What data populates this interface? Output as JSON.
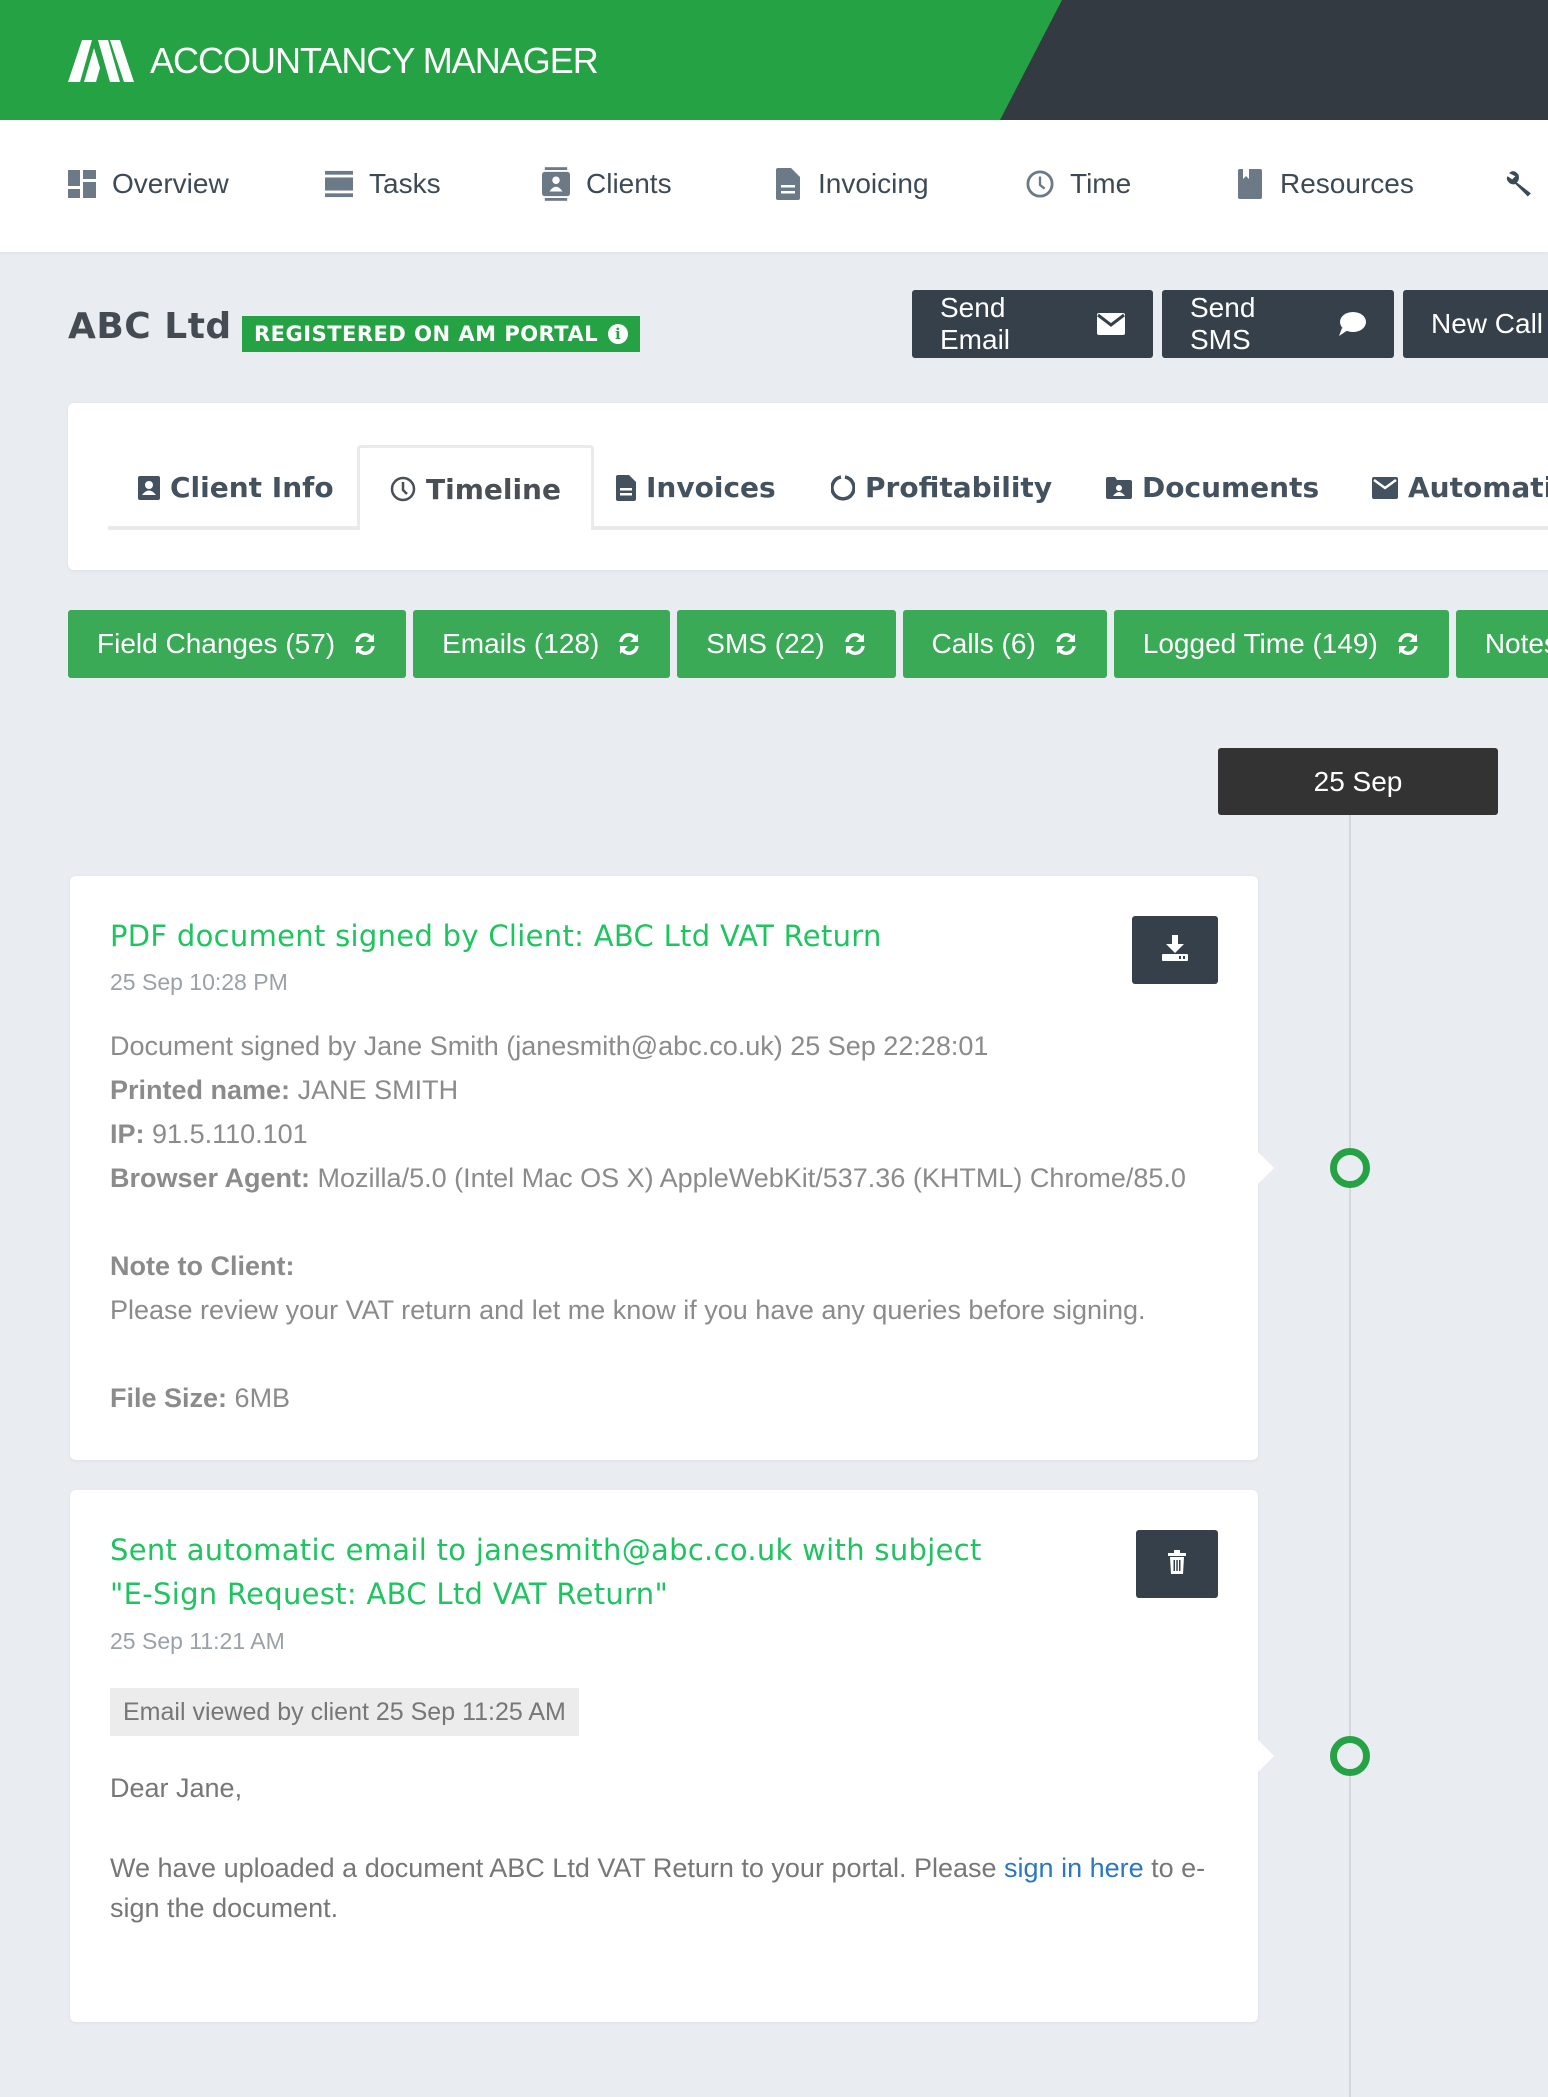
{
  "app": {
    "logo_text": "ACCOUNTANCY MANAGER",
    "brand_color": "#25a244",
    "dark_color": "#343a42"
  },
  "nav": {
    "items": [
      {
        "label": "Overview",
        "icon": "dashboard-icon"
      },
      {
        "label": "Tasks",
        "icon": "tasks-list-icon"
      },
      {
        "label": "Clients",
        "icon": "contact-card-icon"
      },
      {
        "label": "Invoicing",
        "icon": "document-icon"
      },
      {
        "label": "Time",
        "icon": "clock-icon"
      },
      {
        "label": "Resources",
        "icon": "book-icon"
      },
      {
        "label": "",
        "icon": "wrench-icon"
      }
    ]
  },
  "client": {
    "name": "ABC Ltd",
    "badge": "REGISTERED ON AM PORTAL"
  },
  "actions": {
    "send_email": "Send Email",
    "send_sms": "Send SMS",
    "new_call": "New Call"
  },
  "tabs": [
    {
      "label": "Client Info",
      "icon": "contact-card-icon",
      "active": false
    },
    {
      "label": "Timeline",
      "icon": "clock-icon",
      "active": true
    },
    {
      "label": "Invoices",
      "icon": "document-icon",
      "active": false
    },
    {
      "label": "Profitability",
      "icon": "spinner-icon",
      "active": false
    },
    {
      "label": "Documents",
      "icon": "folder-user-icon",
      "active": false
    },
    {
      "label": "Automatic",
      "icon": "envelope-icon",
      "active": false
    }
  ],
  "filters": [
    {
      "label": "Field Changes (57)"
    },
    {
      "label": "Emails (128)"
    },
    {
      "label": "SMS (22)"
    },
    {
      "label": "Calls (6)"
    },
    {
      "label": "Logged Time (149)"
    },
    {
      "label": "Notes"
    }
  ],
  "timeline": {
    "date_label": "25 Sep",
    "events": [
      {
        "title": "PDF document signed by Client: ABC Ltd VAT Return",
        "date": "25 Sep 10:28 PM",
        "signed_line": "Document signed by Jane Smith (janesmith@abc.co.uk) 25 Sep 22:28:01",
        "printed_name_label": "Printed name:",
        "printed_name": "JANE SMITH",
        "ip_label": "IP:",
        "ip": "91.5.110.101",
        "browser_label": "Browser Agent:",
        "browser": "Mozilla/5.0 (Intel Mac OS X) AppleWebKit/537.36 (KHTML) Chrome/85.0",
        "note_label": "Note to Client:",
        "note": "Please review your VAT return and let me know if you have any queries before signing.",
        "file_size_label": "File Size:",
        "file_size": "6MB",
        "action_icon": "download-icon"
      },
      {
        "title_line1": "Sent automatic email to janesmith@abc.co.uk with subject",
        "title_line2": "\"E-Sign Request: ABC Ltd VAT Return\"",
        "date": "25 Sep 11:21 AM",
        "viewed": "Email viewed by client 25 Sep 11:25 AM",
        "greeting": "Dear Jane,",
        "body_before": "We have uploaded a document ABC Ltd VAT Return to your portal. Please ",
        "body_link": "sign in here",
        "body_after": " to e-sign the document.",
        "action_icon": "trash-icon"
      }
    ]
  }
}
